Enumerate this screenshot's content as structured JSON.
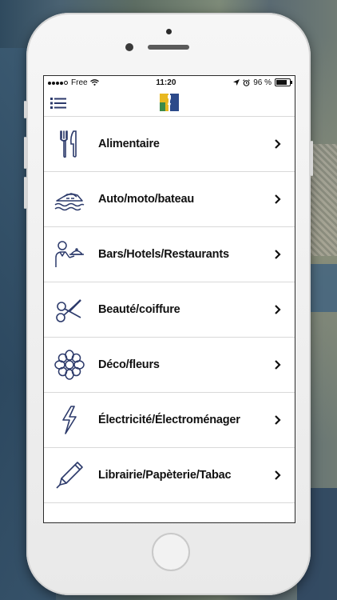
{
  "status_bar": {
    "carrier": "Free",
    "time": "11:20",
    "battery": "96 %",
    "battery_level": 0.96
  },
  "nav": {
    "menu_icon": "hamburger-menu-icon",
    "logo_icon": "app-logo-icon"
  },
  "categories": [
    {
      "label": "Alimentaire",
      "icon": "fork-knife-icon"
    },
    {
      "label": "Auto/moto/bateau",
      "icon": "boat-icon"
    },
    {
      "label": "Bars/Hotels/Restaurants",
      "icon": "waiter-icon"
    },
    {
      "label": "Beauté/coiffure",
      "icon": "scissors-icon"
    },
    {
      "label": "Déco/fleurs",
      "icon": "flower-icon"
    },
    {
      "label": "Électricité/Électroménager",
      "icon": "lightning-icon"
    },
    {
      "label": "Librairie/Papèterie/Tabac",
      "icon": "pen-icon"
    },
    {
      "label": "",
      "icon": "partial-icon"
    }
  ],
  "colors": {
    "icon_stroke": "#2c3a6b",
    "text": "#111111",
    "divider": "#d9d9d9"
  }
}
